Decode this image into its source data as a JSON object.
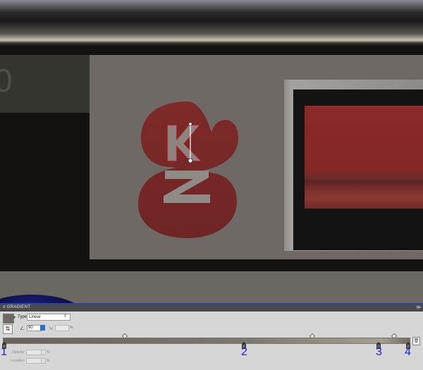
{
  "canvas": {
    "left_panel_glyph": "0"
  },
  "gradient_panel": {
    "title": "≡ GRADIENT",
    "close_glyph": "≫",
    "type_label": "Type",
    "type_value": "Linear",
    "angle_value": "90",
    "aspect_unit": "%",
    "opacity_label": "Opacity:",
    "opacity_unit": "%",
    "location_label": "Location:",
    "location_unit": "%",
    "stop_labels": [
      "1",
      "2",
      "3",
      "4"
    ]
  },
  "logo": {
    "upper_letter": "K",
    "lower_letter": "Z"
  },
  "colors": {
    "accent_blue": "#1a1aff",
    "logo_red": "#7a2827",
    "panel_red": "#8b2a28",
    "panel_border": "#2b3fb8"
  },
  "icons": {
    "angle": "angle-icon",
    "aspect": "aspect-ratio-icon",
    "swap": "reverse-gradient-icon",
    "delete": "trash-icon"
  }
}
